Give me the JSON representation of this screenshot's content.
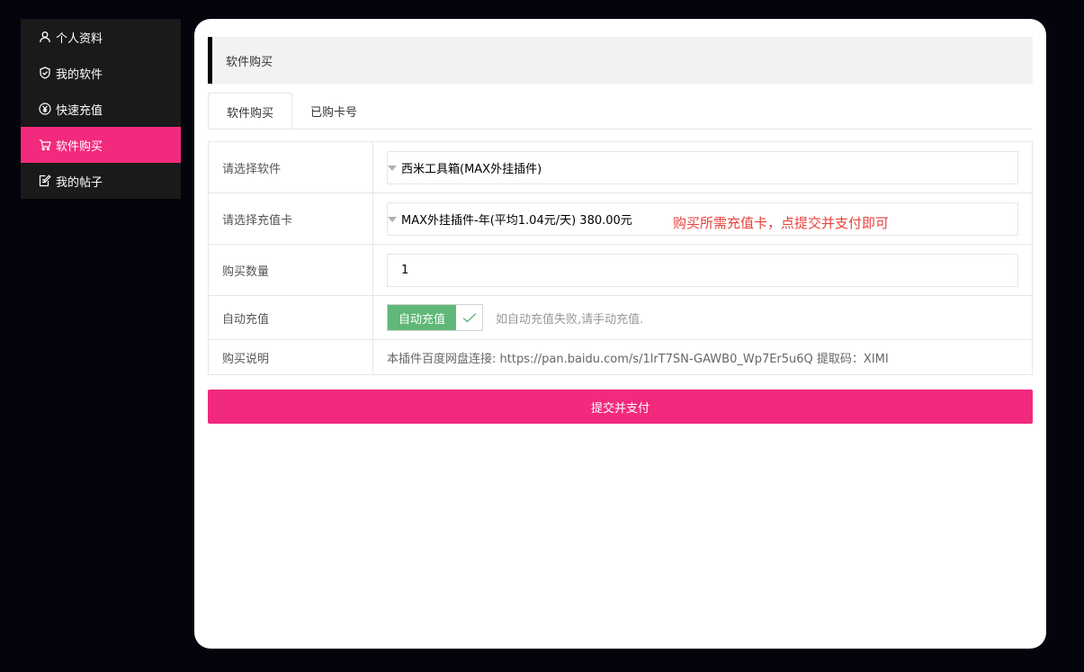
{
  "sidebar": {
    "items": [
      {
        "label": "个人资料",
        "icon": "user-icon"
      },
      {
        "label": "我的软件",
        "icon": "shield-icon"
      },
      {
        "label": "快速充值",
        "icon": "yen-icon"
      },
      {
        "label": "软件购买",
        "icon": "cart-icon",
        "active": true
      },
      {
        "label": "我的帖子",
        "icon": "post-edit-icon"
      }
    ]
  },
  "header": {
    "title": "软件购买"
  },
  "tabs": [
    {
      "label": "软件购买",
      "active": true
    },
    {
      "label": "已购卡号",
      "active": false
    }
  ],
  "form": {
    "software": {
      "label": "请选择软件",
      "value": "西米工具箱(MAX外挂插件)"
    },
    "card": {
      "label": "请选择充值卡",
      "value": "MAX外挂插件-年(平均1.04元/天) 380.00元",
      "hint": "购买所需充值卡，点提交并支付即可"
    },
    "quantity": {
      "label": "购买数量",
      "value": "1"
    },
    "auto_recharge": {
      "label": "自动充值",
      "switch_label": "自动充值",
      "hint": "如自动充值失败,请手动充值."
    },
    "description": {
      "label": "购买说明",
      "text": "本插件百度网盘连接: https://pan.baidu.com/s/1lrT7SN-GAWB0_Wp7Er5u6Q 提取码：XIMI"
    }
  },
  "submit": {
    "label": "提交并支付"
  },
  "colors": {
    "accent": "#f12a7d",
    "switch_green": "#5fb878",
    "hint_red": "#e8413b",
    "sidebar_bg": "#1a1a1a",
    "page_bg": "#03040c"
  }
}
